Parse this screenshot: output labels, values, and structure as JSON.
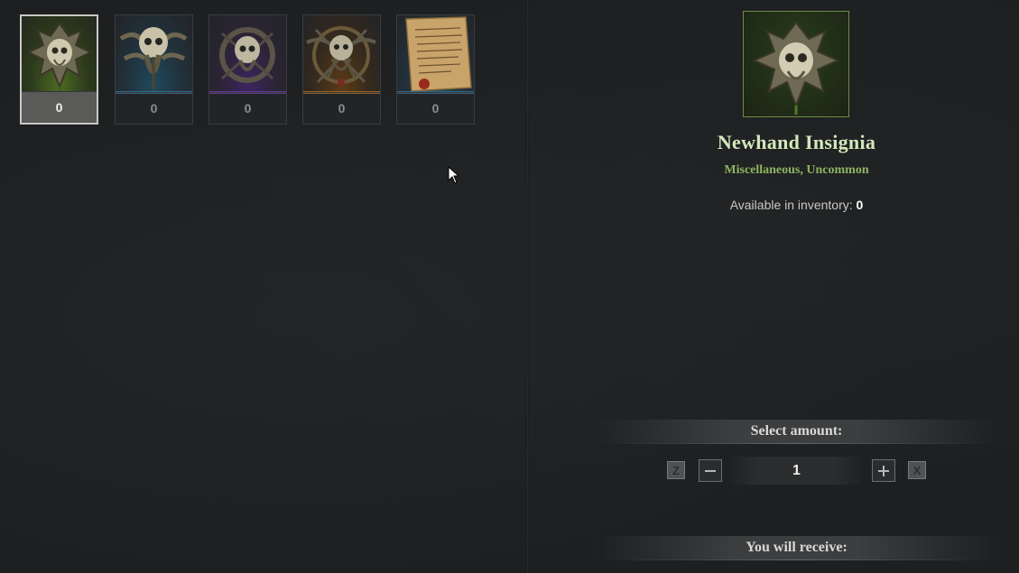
{
  "items": [
    {
      "name": "newhand-insignia",
      "count": "0",
      "rarity_color": "#7da43f",
      "icon": "skull-insignia-icon"
    },
    {
      "name": "crossed-bones-skull",
      "count": "0",
      "rarity_color": "#3f7ea4",
      "icon": "skull-tentacles-icon"
    },
    {
      "name": "cultist-skull",
      "count": "0",
      "rarity_color": "#7a45b8",
      "icon": "skull-wreath-icon"
    },
    {
      "name": "kraken-skull",
      "count": "0",
      "rarity_color": "#b97a2a",
      "icon": "octopus-skull-icon"
    },
    {
      "name": "parchment",
      "count": "0",
      "rarity_color": "#3f7ea4",
      "icon": "parchment-scroll-icon"
    }
  ],
  "detail": {
    "title": "Newhand Insignia",
    "subtitle": "Miscellaneous, Uncommon",
    "inventory_label": "Available in inventory:",
    "inventory_count": "0"
  },
  "amount": {
    "header": "Select amount:",
    "value": "1",
    "min_key": "Z",
    "max_key": "X"
  },
  "receive": {
    "header": "You will receive:"
  }
}
